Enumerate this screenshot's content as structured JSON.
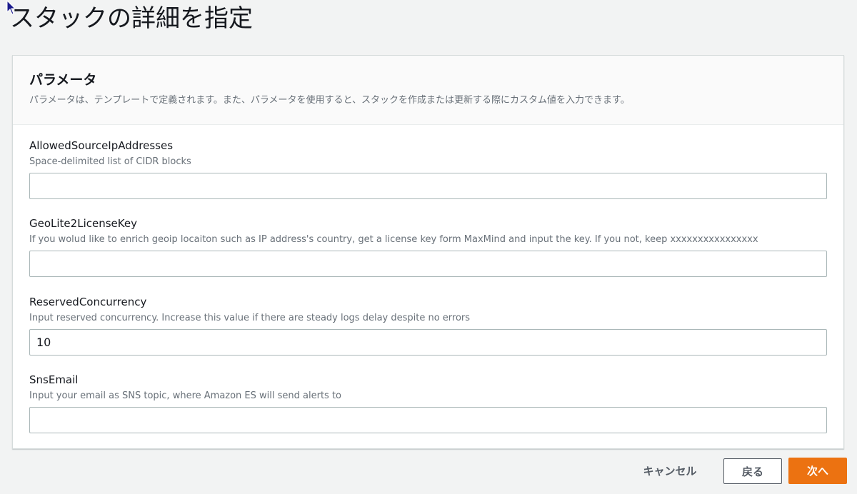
{
  "page": {
    "title": "スタックの詳細を指定"
  },
  "parameters": {
    "title": "パラメータ",
    "description": "パラメータは、テンプレートで定義されます。また、パラメータを使用すると、スタックを作成または更新する際にカスタム値を入力できます。",
    "fields": [
      {
        "label": "AllowedSourceIpAddresses",
        "description": "Space-delimited list of CIDR blocks",
        "value": ""
      },
      {
        "label": "GeoLite2LicenseKey",
        "description": "If you wolud like to enrich geoip locaiton such as IP address's country, get a license key form MaxMind and input the key. If you not, keep xxxxxxxxxxxxxxxx",
        "value": ""
      },
      {
        "label": "ReservedConcurrency",
        "description": "Input reserved concurrency. Increase this value if there are steady logs delay despite no errors",
        "value": "10"
      },
      {
        "label": "SnsEmail",
        "description": "Input your email as SNS topic, where Amazon ES will send alerts to",
        "value": ""
      }
    ]
  },
  "actions": {
    "cancel_label": "キャンセル",
    "back_label": "戻る",
    "next_label": "次へ"
  },
  "colors": {
    "primary_button": "#ec7211",
    "background": "#f2f3f3",
    "cursor": "#1a1a8c"
  },
  "icons": {
    "cursor": "mouse-pointer-icon"
  }
}
